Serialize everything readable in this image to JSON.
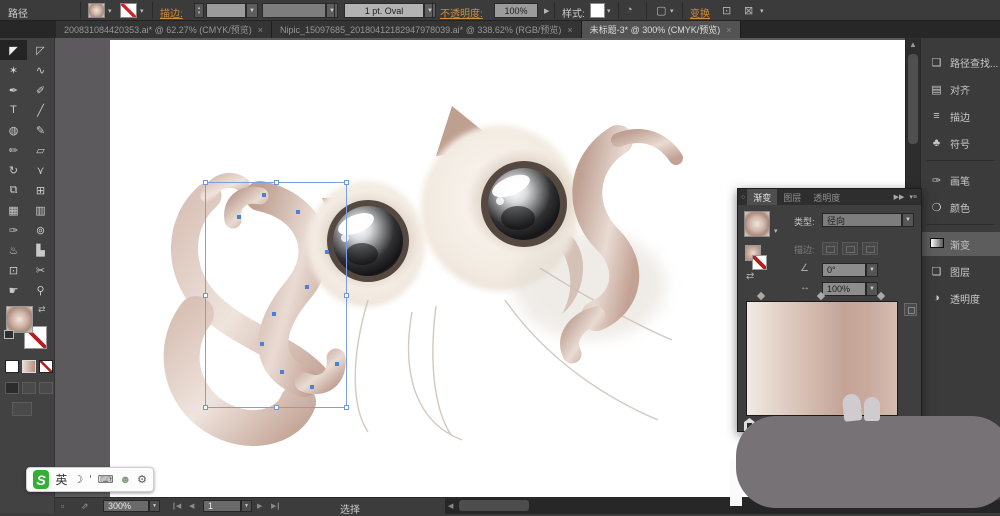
{
  "control_bar": {
    "context_label": "路径",
    "stroke_label": "描边:",
    "brush_value": "1 pt. Oval",
    "opacity_label": "不透明度:",
    "opacity_value": "100%",
    "style_label": "样式:",
    "transform_label": "变换"
  },
  "document_tabs": [
    {
      "title": "200831084420353.ai* @ 62.27% (CMYK/预览)",
      "close": "×"
    },
    {
      "title": "Nipic_15097685_20180412182947978039.ai* @ 338.62% (RGB/预览)",
      "close": "×"
    },
    {
      "title": "未标题-3* @ 300% (CMYK/预览)",
      "close": "×"
    }
  ],
  "toolbar": {
    "tools": [
      {
        "name": "selection-tool",
        "glyph": "◤"
      },
      {
        "name": "direct-selection-tool",
        "glyph": "◸"
      },
      {
        "name": "magic-wand-tool",
        "glyph": "✶"
      },
      {
        "name": "lasso-tool",
        "glyph": "∿"
      },
      {
        "name": "pen-tool",
        "glyph": "✒"
      },
      {
        "name": "blob-brush-tool",
        "glyph": "✐"
      },
      {
        "name": "type-tool",
        "glyph": "T"
      },
      {
        "name": "line-segment-tool",
        "glyph": "╱"
      },
      {
        "name": "ellipse-tool",
        "glyph": "◍"
      },
      {
        "name": "paintbrush-tool",
        "glyph": "✎"
      },
      {
        "name": "pencil-tool",
        "glyph": "✏"
      },
      {
        "name": "eraser-tool",
        "glyph": "▱"
      },
      {
        "name": "rotate-tool",
        "glyph": "↻"
      },
      {
        "name": "width-tool",
        "glyph": "⋎"
      },
      {
        "name": "shape-builder-tool",
        "glyph": "⧉"
      },
      {
        "name": "perspective-grid-tool",
        "glyph": "⊞"
      },
      {
        "name": "mesh-tool",
        "glyph": "▦"
      },
      {
        "name": "gradient-tool",
        "glyph": "▥"
      },
      {
        "name": "eyedropper-tool",
        "glyph": "✑"
      },
      {
        "name": "blend-tool",
        "glyph": "⊚"
      },
      {
        "name": "symbol-sprayer-tool",
        "glyph": "♨"
      },
      {
        "name": "column-graph-tool",
        "glyph": "▙"
      },
      {
        "name": "artboard-tool",
        "glyph": "⊡"
      },
      {
        "name": "slice-tool",
        "glyph": "✂"
      },
      {
        "name": "hand-tool",
        "glyph": "☛"
      },
      {
        "name": "zoom-tool",
        "glyph": "⚲"
      }
    ]
  },
  "dock": {
    "items": [
      {
        "label": "路径查找...",
        "glyph": "❑"
      },
      {
        "label": "对齐",
        "glyph": "▤"
      },
      {
        "label": "描边",
        "glyph": "≡"
      },
      {
        "label": "符号",
        "glyph": "♣"
      },
      {
        "label": "画笔",
        "glyph": "✑"
      },
      {
        "label": "颜色",
        "glyph": "❍"
      },
      {
        "label": "渐变",
        "glyph": ""
      },
      {
        "label": "图层",
        "glyph": "❏"
      },
      {
        "label": "透明度",
        "glyph": "◑"
      }
    ]
  },
  "gradient_panel": {
    "tab_gradient": "渐变",
    "tab_layers": "图层",
    "tab_transparency": "透明度",
    "type_label": "类型:",
    "type_value": "径向",
    "stroke_label": "描边:",
    "angle_value": "0°",
    "aspect_value": "100%"
  },
  "status_bar": {
    "zoom_value": "300%",
    "artboard_value": "1",
    "tool_name": "选择"
  },
  "ime_bar": {
    "lang": "英",
    "icons": [
      {
        "name": "moon-icon",
        "glyph": "☽"
      },
      {
        "name": "punctuation-icon",
        "glyph": "’"
      },
      {
        "name": "keyboard-icon",
        "glyph": "⌨"
      },
      {
        "name": "user-icon",
        "glyph": "☻"
      },
      {
        "name": "wrench-icon",
        "glyph": "⚙"
      }
    ]
  },
  "glyphs": {
    "dropdown": "▼",
    "dropdown_small": "▾",
    "stepper_up": "▴",
    "stepper_down": "▾",
    "arrow_right_small": "▶",
    "scroll_up": "▲",
    "nav_first": "❙◀",
    "nav_prev": "◀",
    "nav_next": "▶",
    "nav_last": "▶❙",
    "hscroll_left": "◀",
    "hscroll_right": "▶",
    "panel_expand": "▶▶",
    "panel_menu": "▾≡",
    "panel_circle": "○",
    "swap": "⇄",
    "angle": "∠",
    "aspect": "↔",
    "recolor": "◔",
    "select_similar": "▢",
    "isolate": "⊡",
    "arrange": "⊠",
    "export": "⇗"
  },
  "colors": {
    "accent_orange": "#d08c3e",
    "selection_blue": "#7aa0e2",
    "tail_dark": "#c3a093",
    "tail_light": "#ecdfd7"
  }
}
